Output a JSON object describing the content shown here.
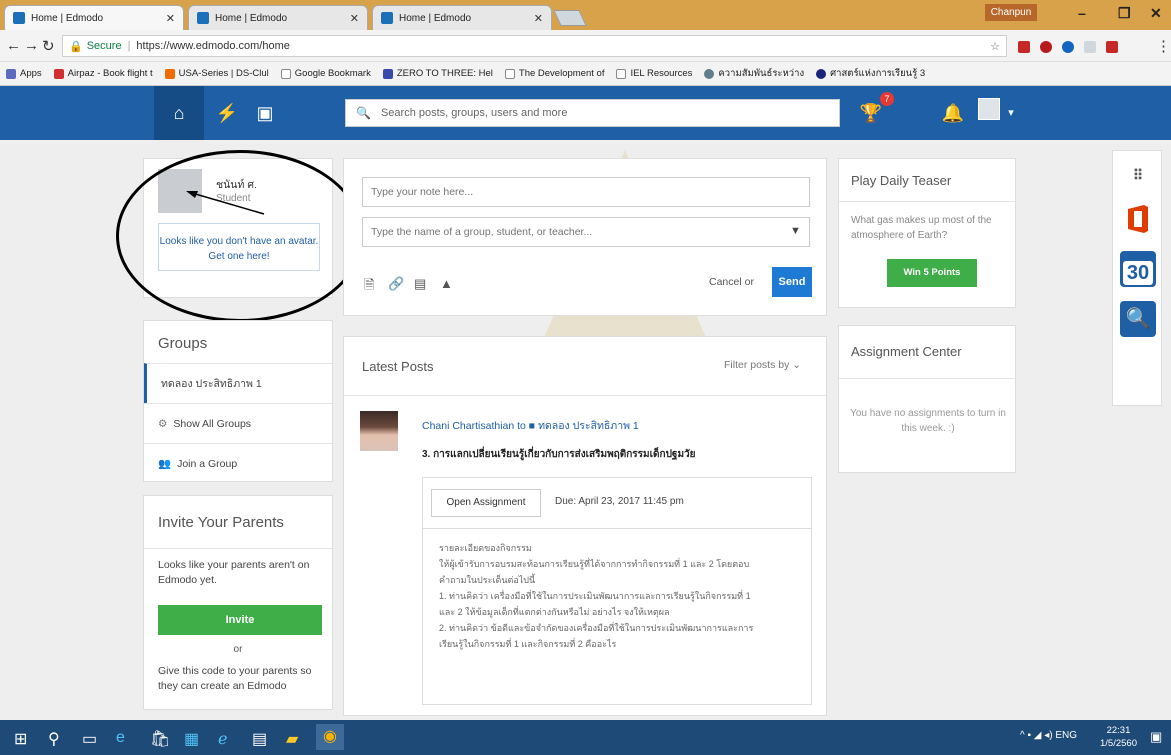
{
  "browser": {
    "tabs": [
      {
        "label": "Home | Edmodo"
      },
      {
        "label": "Home | Edmodo"
      },
      {
        "label": "Home | Edmodo"
      }
    ],
    "profile_name": "Chanpun",
    "address": {
      "secure_label": "Secure",
      "url": "https://www.edmodo.com/home"
    },
    "apps_label": "Apps",
    "bookmarks": [
      "Airpaz - Book flight t",
      "USA-Series | DS-Clul",
      "Google Bookmark",
      "ZERO TO THREE: Hel",
      "The Development of",
      "IEL Resources",
      "ความสัมพันธ์ระหว่าง",
      "ศาสตร์แห่งการเรียนรู้ 3"
    ]
  },
  "navbar": {
    "search_placeholder": "Search posts, groups, users and more",
    "trophy_badge": "7"
  },
  "profile": {
    "name": "ชนันท์ ศ.",
    "role": "Student",
    "avatar_prompt": "Looks like you don't have an avatar. Get one here!"
  },
  "groups": {
    "title": "Groups",
    "items": [
      {
        "label": "ทดลอง ประสิทธิภาพ 1"
      },
      {
        "label": "Show All Groups"
      },
      {
        "label": "Join a Group"
      }
    ]
  },
  "invite": {
    "title": "Invite Your Parents",
    "text": "Looks like your parents aren't on Edmodo yet.",
    "button": "Invite",
    "or": "or",
    "code_text": "Give this code to your parents so they can create an Edmodo"
  },
  "composer": {
    "note_placeholder": "Type your note here...",
    "recipient_placeholder": "Type the name of a group, student, or teacher...",
    "cancel": "Cancel or",
    "send": "Send"
  },
  "posts": {
    "title": "Latest Posts",
    "filter": "Filter posts by",
    "post": {
      "author": "Chani Chartisathian to ■ ทดลอง ประสิทธิภาพ 1",
      "title": "3. การแลกเปลี่ยนเรียนรู้เกี่ยวกับการส่งเสริมพฤติกรรมเด็กปฐมวัย",
      "open_button": "Open Assignment",
      "due": "Due: April 23, 2017 11:45 pm",
      "body": [
        "รายละเอียดของกิจกรรม",
        "ให้ผู้เข้ารับการอบรมสะท้อนการเรียนรู้ที่ได้จากการทำกิจกรรมที่ 1 และ 2 โดยตอบ",
        "คำถามในประเด็นต่อไปนี้",
        "1. ท่านคิดว่า เครื่องมือที่ใช้ในการประเมินพัฒนาการและการเรียนรู้ในกิจกรรมที่ 1",
        "และ 2 ให้ข้อมูลเด็กที่แตกต่างกันหรือไม่ อย่างไร จงให้เหตุผล",
        "2. ท่านคิดว่า ข้อดีและข้อจำกัดของเครื่องมือที่ใช้ในการประเมินพัฒนาการและการ",
        "เรียนรู้ในกิจกรรมที่ 1 และกิจกรรมที่ 2 คืออะไร"
      ]
    }
  },
  "teaser": {
    "title": "Play Daily Teaser",
    "question": "What gas makes up most of the atmosphere of Earth?",
    "button": "Win 5 Points"
  },
  "assignments": {
    "title": "Assignment Center",
    "empty": "You have no assignments to turn in this week. :)"
  },
  "apps": {
    "calendar_day": "30"
  },
  "taskbar": {
    "language": "ENG",
    "time": "22:31",
    "date": "1/5/2560"
  },
  "colors": {
    "navbar": "#1f5fa6",
    "green": "#3fae49",
    "send": "#1f7ad6"
  }
}
